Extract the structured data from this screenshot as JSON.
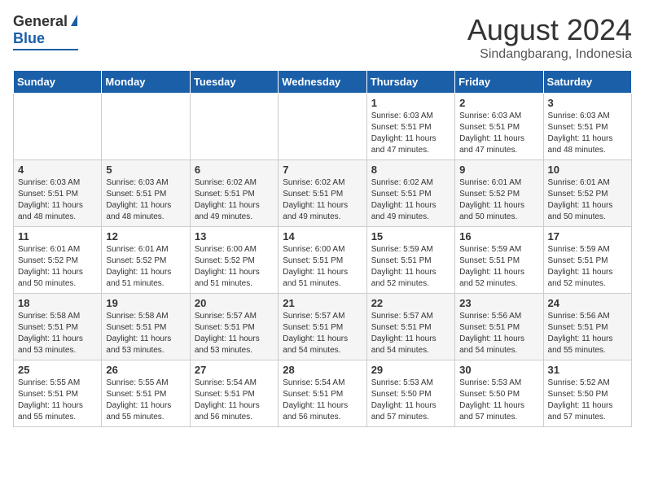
{
  "header": {
    "logo_general": "General",
    "logo_blue": "Blue",
    "main_title": "August 2024",
    "subtitle": "Sindangbarang, Indonesia"
  },
  "weekdays": [
    "Sunday",
    "Monday",
    "Tuesday",
    "Wednesday",
    "Thursday",
    "Friday",
    "Saturday"
  ],
  "weeks": [
    [
      {
        "day": "",
        "text": ""
      },
      {
        "day": "",
        "text": ""
      },
      {
        "day": "",
        "text": ""
      },
      {
        "day": "",
        "text": ""
      },
      {
        "day": "1",
        "text": "Sunrise: 6:03 AM\nSunset: 5:51 PM\nDaylight: 11 hours\nand 47 minutes."
      },
      {
        "day": "2",
        "text": "Sunrise: 6:03 AM\nSunset: 5:51 PM\nDaylight: 11 hours\nand 47 minutes."
      },
      {
        "day": "3",
        "text": "Sunrise: 6:03 AM\nSunset: 5:51 PM\nDaylight: 11 hours\nand 48 minutes."
      }
    ],
    [
      {
        "day": "4",
        "text": "Sunrise: 6:03 AM\nSunset: 5:51 PM\nDaylight: 11 hours\nand 48 minutes."
      },
      {
        "day": "5",
        "text": "Sunrise: 6:03 AM\nSunset: 5:51 PM\nDaylight: 11 hours\nand 48 minutes."
      },
      {
        "day": "6",
        "text": "Sunrise: 6:02 AM\nSunset: 5:51 PM\nDaylight: 11 hours\nand 49 minutes."
      },
      {
        "day": "7",
        "text": "Sunrise: 6:02 AM\nSunset: 5:51 PM\nDaylight: 11 hours\nand 49 minutes."
      },
      {
        "day": "8",
        "text": "Sunrise: 6:02 AM\nSunset: 5:51 PM\nDaylight: 11 hours\nand 49 minutes."
      },
      {
        "day": "9",
        "text": "Sunrise: 6:01 AM\nSunset: 5:52 PM\nDaylight: 11 hours\nand 50 minutes."
      },
      {
        "day": "10",
        "text": "Sunrise: 6:01 AM\nSunset: 5:52 PM\nDaylight: 11 hours\nand 50 minutes."
      }
    ],
    [
      {
        "day": "11",
        "text": "Sunrise: 6:01 AM\nSunset: 5:52 PM\nDaylight: 11 hours\nand 50 minutes."
      },
      {
        "day": "12",
        "text": "Sunrise: 6:01 AM\nSunset: 5:52 PM\nDaylight: 11 hours\nand 51 minutes."
      },
      {
        "day": "13",
        "text": "Sunrise: 6:00 AM\nSunset: 5:52 PM\nDaylight: 11 hours\nand 51 minutes."
      },
      {
        "day": "14",
        "text": "Sunrise: 6:00 AM\nSunset: 5:51 PM\nDaylight: 11 hours\nand 51 minutes."
      },
      {
        "day": "15",
        "text": "Sunrise: 5:59 AM\nSunset: 5:51 PM\nDaylight: 11 hours\nand 52 minutes."
      },
      {
        "day": "16",
        "text": "Sunrise: 5:59 AM\nSunset: 5:51 PM\nDaylight: 11 hours\nand 52 minutes."
      },
      {
        "day": "17",
        "text": "Sunrise: 5:59 AM\nSunset: 5:51 PM\nDaylight: 11 hours\nand 52 minutes."
      }
    ],
    [
      {
        "day": "18",
        "text": "Sunrise: 5:58 AM\nSunset: 5:51 PM\nDaylight: 11 hours\nand 53 minutes."
      },
      {
        "day": "19",
        "text": "Sunrise: 5:58 AM\nSunset: 5:51 PM\nDaylight: 11 hours\nand 53 minutes."
      },
      {
        "day": "20",
        "text": "Sunrise: 5:57 AM\nSunset: 5:51 PM\nDaylight: 11 hours\nand 53 minutes."
      },
      {
        "day": "21",
        "text": "Sunrise: 5:57 AM\nSunset: 5:51 PM\nDaylight: 11 hours\nand 54 minutes."
      },
      {
        "day": "22",
        "text": "Sunrise: 5:57 AM\nSunset: 5:51 PM\nDaylight: 11 hours\nand 54 minutes."
      },
      {
        "day": "23",
        "text": "Sunrise: 5:56 AM\nSunset: 5:51 PM\nDaylight: 11 hours\nand 54 minutes."
      },
      {
        "day": "24",
        "text": "Sunrise: 5:56 AM\nSunset: 5:51 PM\nDaylight: 11 hours\nand 55 minutes."
      }
    ],
    [
      {
        "day": "25",
        "text": "Sunrise: 5:55 AM\nSunset: 5:51 PM\nDaylight: 11 hours\nand 55 minutes."
      },
      {
        "day": "26",
        "text": "Sunrise: 5:55 AM\nSunset: 5:51 PM\nDaylight: 11 hours\nand 55 minutes."
      },
      {
        "day": "27",
        "text": "Sunrise: 5:54 AM\nSunset: 5:51 PM\nDaylight: 11 hours\nand 56 minutes."
      },
      {
        "day": "28",
        "text": "Sunrise: 5:54 AM\nSunset: 5:51 PM\nDaylight: 11 hours\nand 56 minutes."
      },
      {
        "day": "29",
        "text": "Sunrise: 5:53 AM\nSunset: 5:50 PM\nDaylight: 11 hours\nand 57 minutes."
      },
      {
        "day": "30",
        "text": "Sunrise: 5:53 AM\nSunset: 5:50 PM\nDaylight: 11 hours\nand 57 minutes."
      },
      {
        "day": "31",
        "text": "Sunrise: 5:52 AM\nSunset: 5:50 PM\nDaylight: 11 hours\nand 57 minutes."
      }
    ]
  ]
}
